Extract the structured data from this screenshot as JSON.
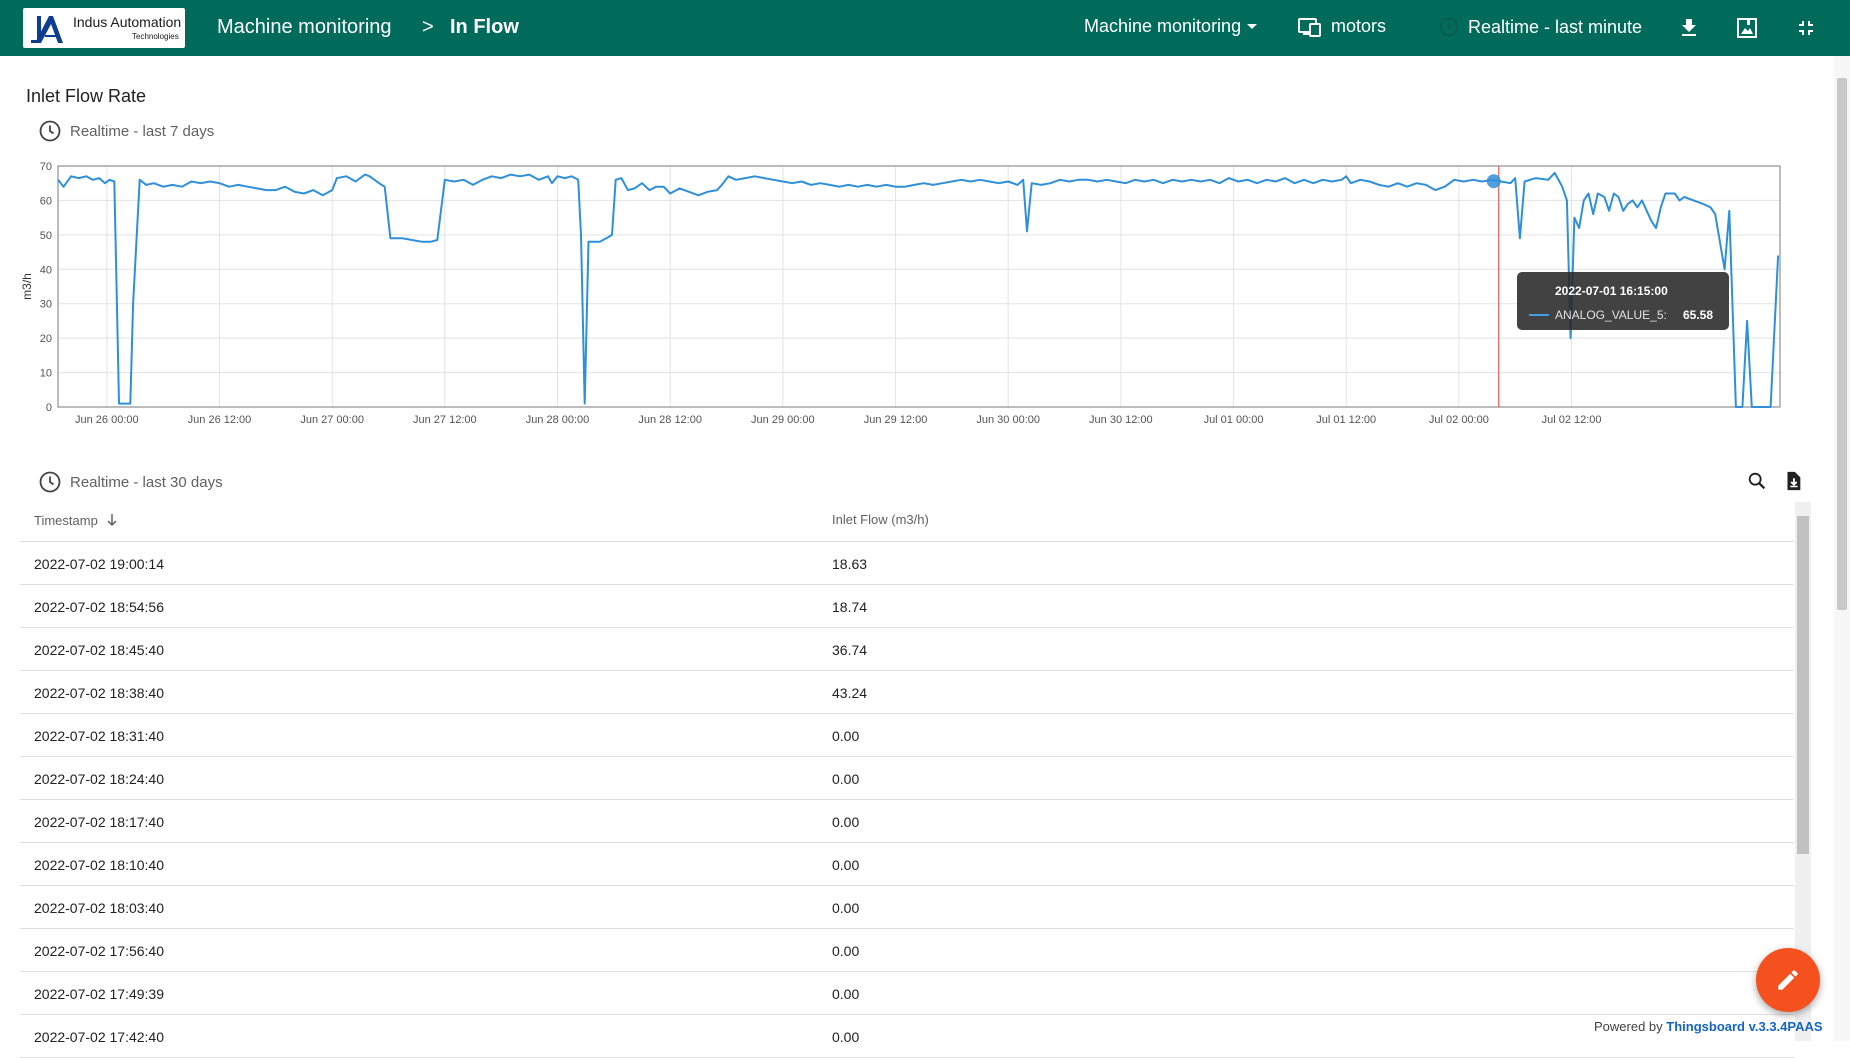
{
  "header": {
    "logo_name": "Indus Automation",
    "logo_sub": "Technologies",
    "breadcrumb": [
      "Machine monitoring",
      ">",
      "In Flow"
    ],
    "dashboard_select": "Machine monitoring",
    "entity_label": "motors",
    "timewindow_label": "Realtime - last minute"
  },
  "widget_chart": {
    "title": "Inlet Flow Rate",
    "timewindow": "Realtime - last 7 days",
    "tooltip": {
      "time": "2022-07-01 16:15:00",
      "series": "ANALOG_VALUE_5:",
      "value": "65.58"
    }
  },
  "chart_data": {
    "type": "line",
    "title": "",
    "xlabel": "",
    "ylabel": "m3/h",
    "ylim": [
      0,
      70
    ],
    "yticks": [
      "0",
      "10",
      "20",
      "30",
      "40",
      "50",
      "60",
      "70"
    ],
    "xticks": [
      "Jun 26 00:00",
      "Jun 26 12:00",
      "Jun 27 00:00",
      "Jun 27 12:00",
      "Jun 28 00:00",
      "Jun 28 12:00",
      "Jun 29 00:00",
      "Jun 29 12:00",
      "Jun 30 00:00",
      "Jun 30 12:00",
      "Jul 01 00:00",
      "Jul 01 12:00",
      "Jul 02 00:00",
      "Jul 02 12:00"
    ],
    "grid": true,
    "color": "#2f8fd8",
    "series": [
      {
        "name": "ANALOG_VALUE_5",
        "points": [
          [
            -5.2,
            66
          ],
          [
            -4.6,
            64
          ],
          [
            -3.8,
            67
          ],
          [
            -3.0,
            66.5
          ],
          [
            -2.2,
            67
          ],
          [
            -1.5,
            66
          ],
          [
            -0.8,
            66.5
          ],
          [
            -0.2,
            65
          ],
          [
            0.3,
            66
          ],
          [
            0.8,
            65.5
          ],
          [
            1.0,
            40
          ],
          [
            1.3,
            1
          ],
          [
            2.5,
            1
          ],
          [
            2.8,
            30
          ],
          [
            3.5,
            66
          ],
          [
            4.2,
            64.5
          ],
          [
            5.0,
            65
          ],
          [
            6.0,
            64
          ],
          [
            7.0,
            64.5
          ],
          [
            8.0,
            64
          ],
          [
            9.0,
            65.5
          ],
          [
            10.0,
            65
          ],
          [
            11.0,
            65.5
          ],
          [
            12.0,
            65
          ],
          [
            13.0,
            64
          ],
          [
            14.0,
            64.5
          ],
          [
            15.0,
            64
          ],
          [
            16.0,
            63.5
          ],
          [
            17.0,
            63
          ],
          [
            18.0,
            63
          ],
          [
            19.0,
            64
          ],
          [
            20.0,
            62.5
          ],
          [
            21.0,
            62
          ],
          [
            22.0,
            63
          ],
          [
            23.0,
            61.5
          ],
          [
            24.0,
            63
          ],
          [
            24.5,
            66.5
          ],
          [
            25.5,
            67
          ],
          [
            26.5,
            65.5
          ],
          [
            27.5,
            67.5
          ],
          [
            28.0,
            67
          ],
          [
            29.0,
            65
          ],
          [
            29.6,
            64
          ],
          [
            30.2,
            49
          ],
          [
            31.5,
            49
          ],
          [
            32.5,
            48.5
          ],
          [
            33.5,
            48
          ],
          [
            34.5,
            48
          ],
          [
            35.2,
            48.5
          ],
          [
            36.0,
            66
          ],
          [
            37.0,
            65.5
          ],
          [
            38.0,
            66
          ],
          [
            39.0,
            64.5
          ],
          [
            40.0,
            66
          ],
          [
            41.0,
            67
          ],
          [
            42.0,
            66.5
          ],
          [
            43.0,
            67.5
          ],
          [
            44.0,
            67
          ],
          [
            45.0,
            67.5
          ],
          [
            46.0,
            66
          ],
          [
            47.0,
            67
          ],
          [
            47.4,
            65
          ],
          [
            48.0,
            67
          ],
          [
            48.8,
            66.5
          ],
          [
            49.5,
            67
          ],
          [
            50.2,
            66
          ],
          [
            50.5,
            50
          ],
          [
            50.9,
            1
          ],
          [
            51.3,
            48
          ],
          [
            52.5,
            48
          ],
          [
            53.2,
            49
          ],
          [
            53.8,
            50
          ],
          [
            54.2,
            66
          ],
          [
            54.8,
            66.5
          ],
          [
            55.5,
            63
          ],
          [
            56.2,
            63.5
          ],
          [
            57.0,
            65
          ],
          [
            57.8,
            63
          ],
          [
            58.5,
            64
          ],
          [
            59.3,
            64
          ],
          [
            60.0,
            62
          ],
          [
            61.0,
            63.5
          ],
          [
            62.0,
            62.5
          ],
          [
            63.0,
            61.5
          ],
          [
            64.0,
            62.5
          ],
          [
            65.0,
            63
          ],
          [
            65.5,
            64.5
          ],
          [
            66.2,
            67
          ],
          [
            67.0,
            66
          ],
          [
            68.0,
            66.5
          ],
          [
            69.0,
            67
          ],
          [
            70.0,
            66.5
          ],
          [
            71.0,
            66
          ],
          [
            72.0,
            65.5
          ],
          [
            73.0,
            65
          ],
          [
            74.0,
            65.5
          ],
          [
            75.0,
            64.5
          ],
          [
            76.0,
            65
          ],
          [
            77.0,
            64.5
          ],
          [
            78.0,
            64
          ],
          [
            79.0,
            64.5
          ],
          [
            80.0,
            64
          ],
          [
            81.0,
            64.5
          ],
          [
            82.0,
            64
          ],
          [
            83.0,
            64.5
          ],
          [
            84.0,
            64
          ],
          [
            85.0,
            64
          ],
          [
            86.0,
            64.5
          ],
          [
            87.0,
            65
          ],
          [
            88.0,
            64.5
          ],
          [
            89.0,
            65
          ],
          [
            90.0,
            65.5
          ],
          [
            91.0,
            66
          ],
          [
            92.0,
            65.5
          ],
          [
            93.0,
            66
          ],
          [
            94.0,
            65.5
          ],
          [
            95.0,
            65
          ],
          [
            96.0,
            65.5
          ],
          [
            97.0,
            64.5
          ],
          [
            97.6,
            66
          ],
          [
            98.0,
            51
          ],
          [
            98.5,
            65
          ],
          [
            99.5,
            64.5
          ],
          [
            100.5,
            65
          ],
          [
            101.5,
            66
          ],
          [
            102.5,
            65.5
          ],
          [
            103.5,
            66
          ],
          [
            104.5,
            66
          ],
          [
            105.5,
            65.5
          ],
          [
            106.5,
            66
          ],
          [
            107.5,
            65.5
          ],
          [
            108.5,
            65
          ],
          [
            109.5,
            66
          ],
          [
            110.5,
            65.5
          ],
          [
            111.5,
            66
          ],
          [
            112.5,
            65
          ],
          [
            113.5,
            66
          ],
          [
            114.5,
            65.5
          ],
          [
            115.5,
            66
          ],
          [
            116.5,
            65.5
          ],
          [
            117.5,
            66
          ],
          [
            118.5,
            65
          ],
          [
            119.5,
            66.5
          ],
          [
            120.5,
            65.5
          ],
          [
            121.5,
            66
          ],
          [
            122.5,
            65
          ],
          [
            123.5,
            66
          ],
          [
            124.5,
            65.5
          ],
          [
            125.5,
            66.5
          ],
          [
            126.5,
            65
          ],
          [
            127.5,
            66
          ],
          [
            128.5,
            65
          ],
          [
            129.5,
            66
          ],
          [
            130.5,
            65.5
          ],
          [
            131.5,
            66
          ],
          [
            132.0,
            67
          ],
          [
            132.5,
            65
          ],
          [
            133.5,
            66
          ],
          [
            134.5,
            65.5
          ],
          [
            135.5,
            64.5
          ],
          [
            136.5,
            64
          ],
          [
            137.5,
            65
          ],
          [
            138.5,
            64
          ],
          [
            139.5,
            65
          ],
          [
            140.5,
            64.5
          ],
          [
            141.5,
            63
          ],
          [
            142.5,
            64
          ],
          [
            143.5,
            66
          ],
          [
            144.5,
            65.5
          ],
          [
            145.5,
            66
          ],
          [
            146.5,
            65.5
          ],
          [
            147.5,
            66
          ],
          [
            148.5,
            65.5
          ],
          [
            149.5,
            65
          ],
          [
            150.0,
            66.5
          ],
          [
            150.5,
            49
          ],
          [
            151.0,
            65.5
          ],
          [
            152.2,
            66.5
          ],
          [
            153.5,
            66
          ],
          [
            154.2,
            68
          ],
          [
            155.0,
            64
          ],
          [
            155.5,
            60
          ],
          [
            155.9,
            20
          ],
          [
            156.3,
            55
          ],
          [
            156.8,
            52
          ],
          [
            157.3,
            60
          ],
          [
            157.8,
            62
          ],
          [
            158.3,
            56
          ],
          [
            158.8,
            62
          ],
          [
            159.5,
            61
          ],
          [
            160.0,
            57
          ],
          [
            160.5,
            62
          ],
          [
            161.0,
            61
          ],
          [
            161.5,
            57
          ],
          [
            162.0,
            59
          ],
          [
            162.5,
            60
          ],
          [
            163.0,
            58
          ],
          [
            163.5,
            60
          ],
          [
            164.5,
            54
          ],
          [
            165.0,
            52
          ],
          [
            165.5,
            58
          ],
          [
            166.0,
            62
          ],
          [
            167.0,
            62
          ],
          [
            167.5,
            60
          ],
          [
            168.0,
            61
          ],
          [
            169.0,
            60
          ],
          [
            170.0,
            59
          ],
          [
            170.8,
            58
          ],
          [
            171.3,
            56
          ],
          [
            172.3,
            40
          ],
          [
            172.8,
            57
          ],
          [
            173.5,
            0
          ],
          [
            174.2,
            0
          ],
          [
            174.7,
            25
          ],
          [
            175.2,
            0
          ],
          [
            176.5,
            0
          ],
          [
            177.2,
            0
          ],
          [
            178.0,
            44
          ]
        ]
      }
    ]
  },
  "widget_table": {
    "timewindow": "Realtime - last 30 days",
    "columns": [
      "Timestamp",
      "Inlet Flow (m3/h)"
    ],
    "rows": [
      [
        "2022-07-02 19:00:14",
        "18.63"
      ],
      [
        "2022-07-02 18:54:56",
        "18.74"
      ],
      [
        "2022-07-02 18:45:40",
        "36.74"
      ],
      [
        "2022-07-02 18:38:40",
        "43.24"
      ],
      [
        "2022-07-02 18:31:40",
        "0.00"
      ],
      [
        "2022-07-02 18:24:40",
        "0.00"
      ],
      [
        "2022-07-02 18:17:40",
        "0.00"
      ],
      [
        "2022-07-02 18:10:40",
        "0.00"
      ],
      [
        "2022-07-02 18:03:40",
        "0.00"
      ],
      [
        "2022-07-02 17:56:40",
        "0.00"
      ],
      [
        "2022-07-02 17:49:39",
        "0.00"
      ],
      [
        "2022-07-02 17:42:40",
        "0.00"
      ]
    ]
  },
  "footer": {
    "powered_prefix": "Powered by",
    "powered_link": "Thingsboard v.3.3.4PAAS"
  },
  "colors": {
    "header": "#006b5b",
    "line": "#2f8fd8",
    "fab": "#f4511e",
    "cursor": "#e53935"
  }
}
